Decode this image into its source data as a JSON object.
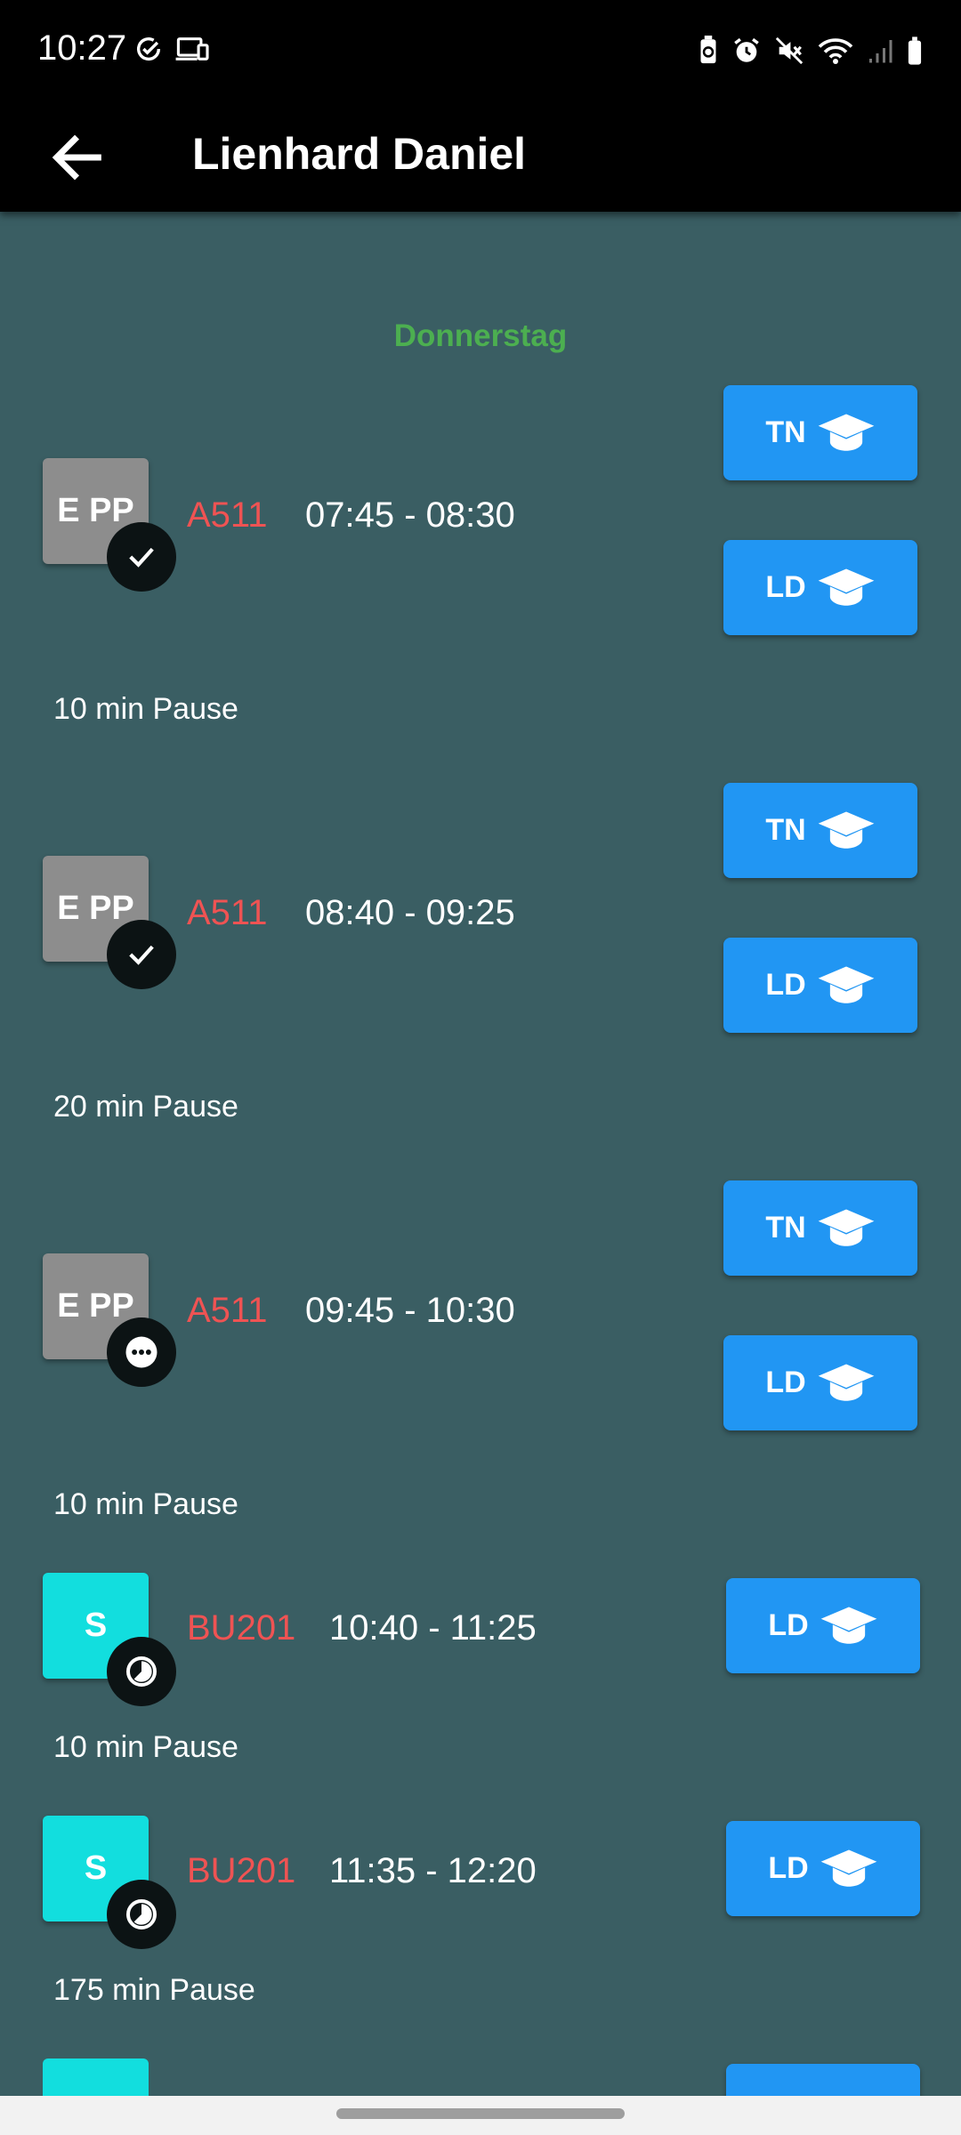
{
  "status_bar": {
    "time": "10:27",
    "left_icons": [
      "check-circle-icon",
      "devices-icon"
    ],
    "right_icons": [
      "battery-saver-icon",
      "alarm-icon",
      "mute-icon",
      "wifi-icon",
      "signal-icon",
      "battery-icon"
    ]
  },
  "app_bar": {
    "back_icon": "arrow-left-icon",
    "title": "Lienhard Daniel"
  },
  "day": "Donnerstag",
  "lessons": [
    {
      "badge": "E PP",
      "badge_color": "#8d8d8d",
      "status_icon": "check-icon",
      "room": "A511",
      "time": "07:45 - 08:30",
      "buttons": [
        "TN",
        "LD"
      ]
    },
    {
      "badge": "E PP",
      "badge_color": "#8d8d8d",
      "status_icon": "check-icon",
      "room": "A511",
      "time": "08:40 - 09:25",
      "buttons": [
        "TN",
        "LD"
      ]
    },
    {
      "badge": "E PP",
      "badge_color": "#8d8d8d",
      "status_icon": "more-dots-icon",
      "room": "A511",
      "time": "09:45 - 10:30",
      "buttons": [
        "TN",
        "LD"
      ]
    },
    {
      "badge": "S",
      "badge_color": "#12dede",
      "status_icon": "clock-icon",
      "room": "BU201",
      "time": "10:40 - 11:25",
      "buttons": [
        "LD"
      ]
    },
    {
      "badge": "S",
      "badge_color": "#12dede",
      "status_icon": "clock-icon",
      "room": "BU201",
      "time": "11:35 - 12:20",
      "buttons": [
        "LD"
      ]
    }
  ],
  "pauses": [
    "10 min Pause",
    "20 min Pause",
    "10 min Pause",
    "10 min Pause",
    "175 min Pause"
  ],
  "button_icon": "graduation-cap-icon",
  "colors": {
    "background": "#3a5e63",
    "day_label": "#4caf50",
    "room": "#ef5353",
    "button": "#2196f3",
    "badge_grey": "#8d8d8d",
    "badge_cyan": "#12dede"
  }
}
